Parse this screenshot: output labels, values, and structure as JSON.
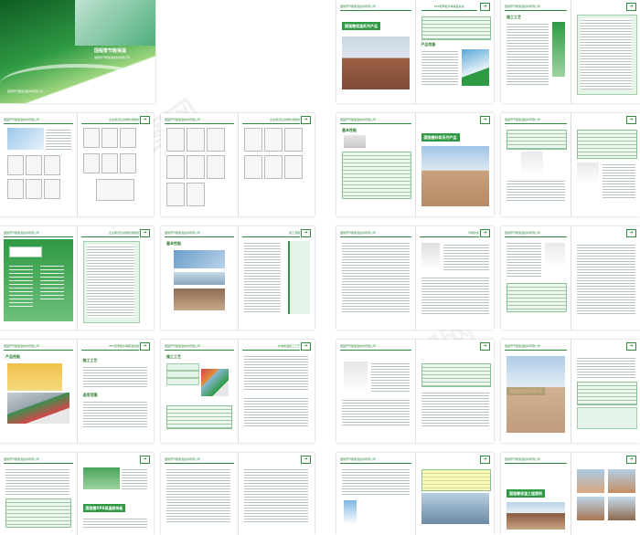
{
  "header_text": "国强雪节能保温建材有限公司",
  "cover": {
    "title": "国程雪节能保温",
    "subtitle": "国强雪节能保温建材有限公司"
  },
  "spreads": [
    {
      "title": "企业概况及资质检测报告"
    },
    {
      "title": "企业概况及资质检测报告"
    },
    {
      "title": "EPS聚苯板外墙保温系统"
    },
    {
      "title": "XPS外墙外保温系统",
      "bar": "国强雪保温系列产品"
    },
    {
      "title": "施工流程",
      "bar": "国强雪砂浆系列产品"
    },
    {
      "title": "外墙保温施工工艺"
    },
    {
      "title": "国强雪保温装饰一体化系列",
      "bar": "国强雪保温系列产品"
    },
    {
      "title": "外墙保温施工工艺"
    },
    {
      "title": "专用砂浆"
    },
    {
      "title": "建筑用外墙保温材料"
    },
    {
      "title": "施工工艺"
    },
    {
      "title": "外墙保温施工工艺"
    },
    {
      "title": "外墙保温装饰工程",
      "bar": "国强雪砂浆系列产品"
    },
    {
      "title": "外墙保温施工工艺"
    },
    {
      "title": "保温工程",
      "bar": "国强雪保温工程案例"
    },
    {
      "title": "保温工程"
    }
  ],
  "labels": {
    "sec_product": "产品性能",
    "sec_basic": "基本性能",
    "sec_apply": "适用范围",
    "sec_construction": "施工工艺",
    "sec_xps": "国强雪XPS保温装饰板",
    "sec_project": "工程案例"
  },
  "colors": {
    "brand_green": "#2f9a44",
    "dark_green": "#1f6e2e",
    "light_green": "#e6f3e8"
  },
  "arrow_icon": "arrow-right-icon"
}
